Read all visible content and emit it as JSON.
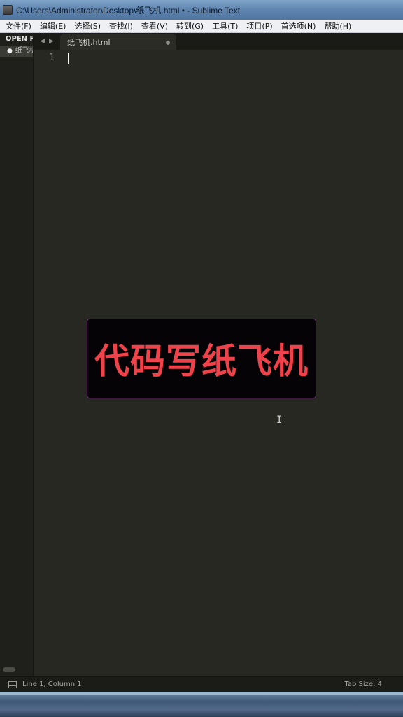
{
  "window": {
    "title": "C:\\Users\\Administrator\\Desktop\\纸飞机.html • - Sublime Text"
  },
  "menu": {
    "items": [
      "文件(F)",
      "编辑(E)",
      "选择(S)",
      "查找(I)",
      "查看(V)",
      "转到(G)",
      "工具(T)",
      "项目(P)",
      "首选项(N)",
      "帮助(H)"
    ]
  },
  "sidebar": {
    "header": "OPEN FILES",
    "file": "纸飞机.html"
  },
  "tabs": {
    "nav_prev": "◀",
    "nav_next": "▶",
    "active_label": "纸飞机.html"
  },
  "editor": {
    "line_number": "1"
  },
  "overlay": {
    "text": "代码写纸飞机"
  },
  "status": {
    "position": "Line 1, Column 1",
    "tab_size": "Tab Size: 4"
  },
  "icons": {
    "app": "sublime-app-icon",
    "panel": "panel-toggle-icon",
    "modified": "modified-dot-icon",
    "mouse": "text-ibeam-cursor-icon"
  },
  "colors": {
    "editor_bg": "#272822",
    "overlay_text": "#f0424b",
    "overlay_bg": "#050305"
  }
}
